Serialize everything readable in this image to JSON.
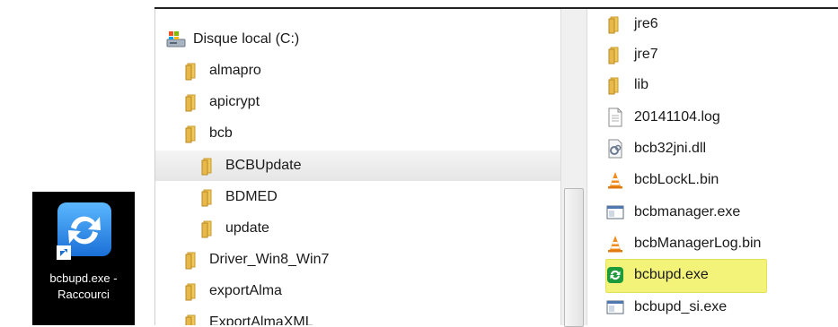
{
  "desktop_shortcut": {
    "label_line1": "bcbupd.exe -",
    "label_line2": "Raccourci"
  },
  "nav_pane": {
    "top_partial": "...",
    "items": [
      {
        "label": "Disque local (C:)",
        "icon": "drive-icon"
      },
      {
        "label": "almapro",
        "icon": "folder-icon"
      },
      {
        "label": "apicrypt",
        "icon": "folder-icon"
      },
      {
        "label": "bcb",
        "icon": "folder-icon"
      },
      {
        "label": "BCBUpdate",
        "icon": "folder-icon",
        "selected": true
      },
      {
        "label": "BDMED",
        "icon": "folder-icon"
      },
      {
        "label": "update",
        "icon": "folder-icon"
      },
      {
        "label": "Driver_Win8_Win7",
        "icon": "folder-icon"
      },
      {
        "label": "exportAlma",
        "icon": "folder-icon"
      },
      {
        "label": "ExportAlmaXML",
        "icon": "folder-icon"
      }
    ]
  },
  "file_pane": {
    "items": [
      {
        "label": "jre6",
        "icon": "folder-icon"
      },
      {
        "label": "jre7",
        "icon": "folder-icon"
      },
      {
        "label": "lib",
        "icon": "folder-icon"
      },
      {
        "label": "20141104.log",
        "icon": "text-file-icon"
      },
      {
        "label": "bcb32jni.dll",
        "icon": "dll-file-icon"
      },
      {
        "label": "bcbLockL.bin",
        "icon": "vlc-cone-icon"
      },
      {
        "label": "bcbmanager.exe",
        "icon": "exe-window-icon"
      },
      {
        "label": "bcbManagerLog.bin",
        "icon": "vlc-cone-icon"
      },
      {
        "label": "bcbupd.exe",
        "icon": "green-update-icon",
        "highlighted": true
      },
      {
        "label": "bcbupd_si.exe",
        "icon": "exe-window-icon"
      }
    ]
  },
  "colors": {
    "highlight": "#f3f37a",
    "folder": "#e8b84a",
    "shortcut_bg": "#000000",
    "app_icon": "#2f8ee8"
  }
}
